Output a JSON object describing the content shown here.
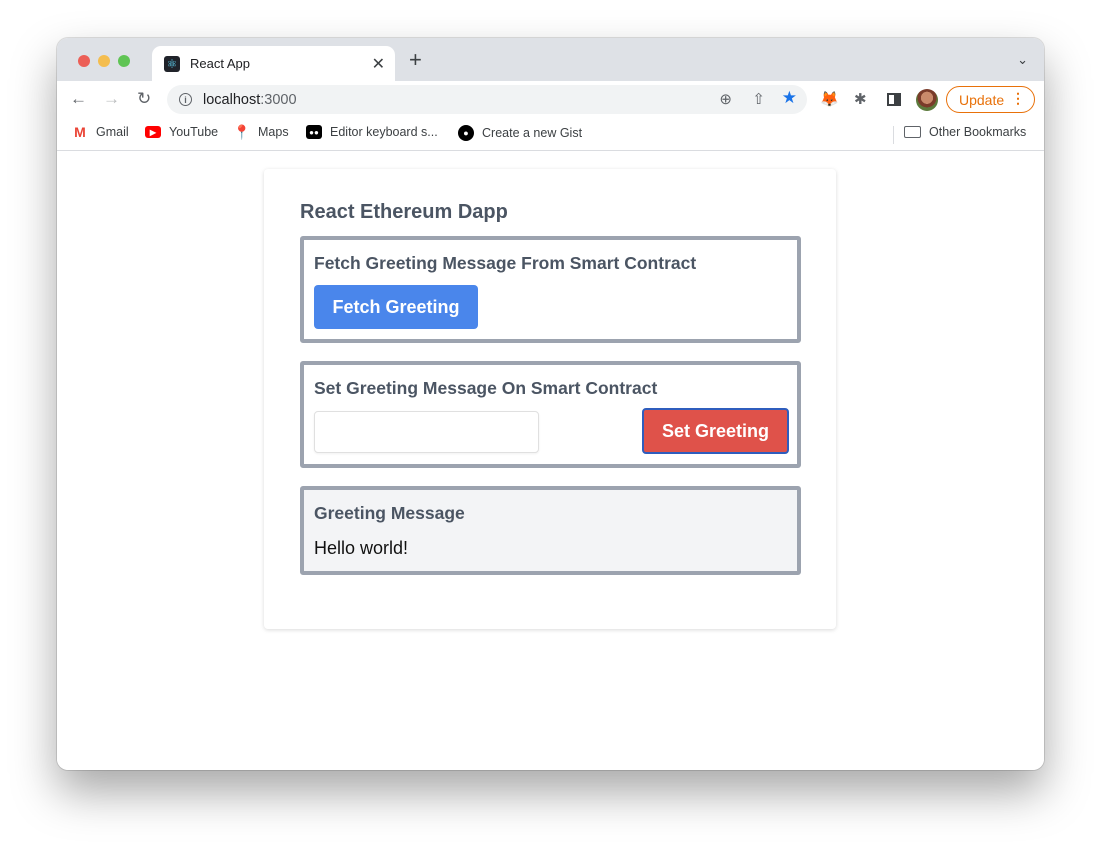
{
  "browser": {
    "tab": {
      "title": "React App",
      "favicon": "react-icon"
    },
    "new_tab_label": "+",
    "address": {
      "host": "localhost",
      "port": ":3000"
    },
    "update_label": "Update",
    "bookmarks": [
      {
        "label": "Gmail",
        "icon": "gmail-icon"
      },
      {
        "label": "YouTube",
        "icon": "youtube-icon"
      },
      {
        "label": "Maps",
        "icon": "maps-icon"
      },
      {
        "label": "Editor keyboard s...",
        "icon": "medium-icon"
      },
      {
        "label": "Create a new Gist",
        "icon": "github-icon"
      }
    ],
    "other_bookmarks": "Other Bookmarks"
  },
  "app": {
    "title": "React Ethereum Dapp",
    "fetch_panel": {
      "heading": "Fetch Greeting Message From Smart Contract",
      "button": "Fetch Greeting"
    },
    "set_panel": {
      "heading": "Set Greeting Message On Smart Contract",
      "input_value": "",
      "input_placeholder": "",
      "button": "Set Greeting"
    },
    "message_panel": {
      "heading": "Greeting Message",
      "message": "Hello world!"
    }
  },
  "colors": {
    "fetch_button": "#4a86eb",
    "set_button": "#df524a",
    "panel_border": "#9ca3af",
    "heading": "#4b5563"
  }
}
